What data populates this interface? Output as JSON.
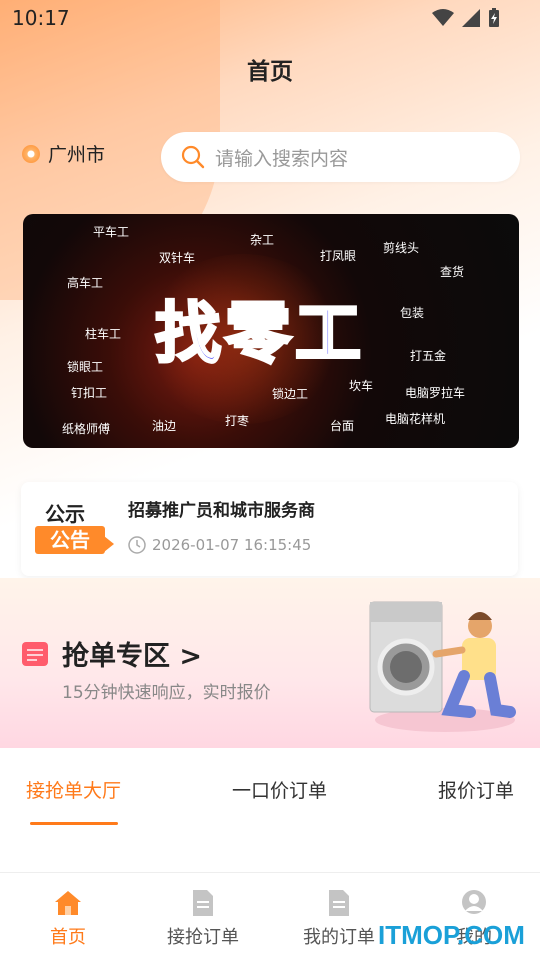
{
  "status": {
    "time": "10:17"
  },
  "header": {
    "title": "首页"
  },
  "location": {
    "city": "广州市"
  },
  "search": {
    "placeholder": "请输入搜索内容"
  },
  "banner": {
    "headline": "找零工",
    "tags": [
      "平车工",
      "杂工",
      "双针车",
      "打凤眼",
      "剪线头",
      "查货",
      "高车工",
      "包装",
      "柱车工",
      "打五金",
      "锁眼工",
      "坎车",
      "钉扣工",
      "锁边工",
      "电脑罗拉车",
      "纸格师傅",
      "油边",
      "打枣",
      "台面",
      "电脑花样机"
    ]
  },
  "notice": {
    "label_top": "公示",
    "label_bottom": "公告",
    "title": "招募推广员和城市服务商",
    "time": "2026-01-07 16:15:45"
  },
  "grab_zone": {
    "title": "抢单专区 >",
    "subtitle": "15分钟快速响应，实时报价"
  },
  "order_tabs": [
    {
      "label": "接抢单大厅",
      "active": true
    },
    {
      "label": "一口价订单",
      "active": false
    },
    {
      "label": "报价订单",
      "active": false
    }
  ],
  "bottom_nav": [
    {
      "label": "首页",
      "icon": "home-icon",
      "active": true
    },
    {
      "label": "接抢订单",
      "icon": "document-icon",
      "active": false
    },
    {
      "label": "我的订单",
      "icon": "document-icon",
      "active": false
    },
    {
      "label": "我的",
      "icon": "user-icon",
      "active": false
    }
  ],
  "watermark": "ITMOP.COM",
  "colors": {
    "accent": "#ff7a1a",
    "watermark": "#1aa0d8"
  }
}
